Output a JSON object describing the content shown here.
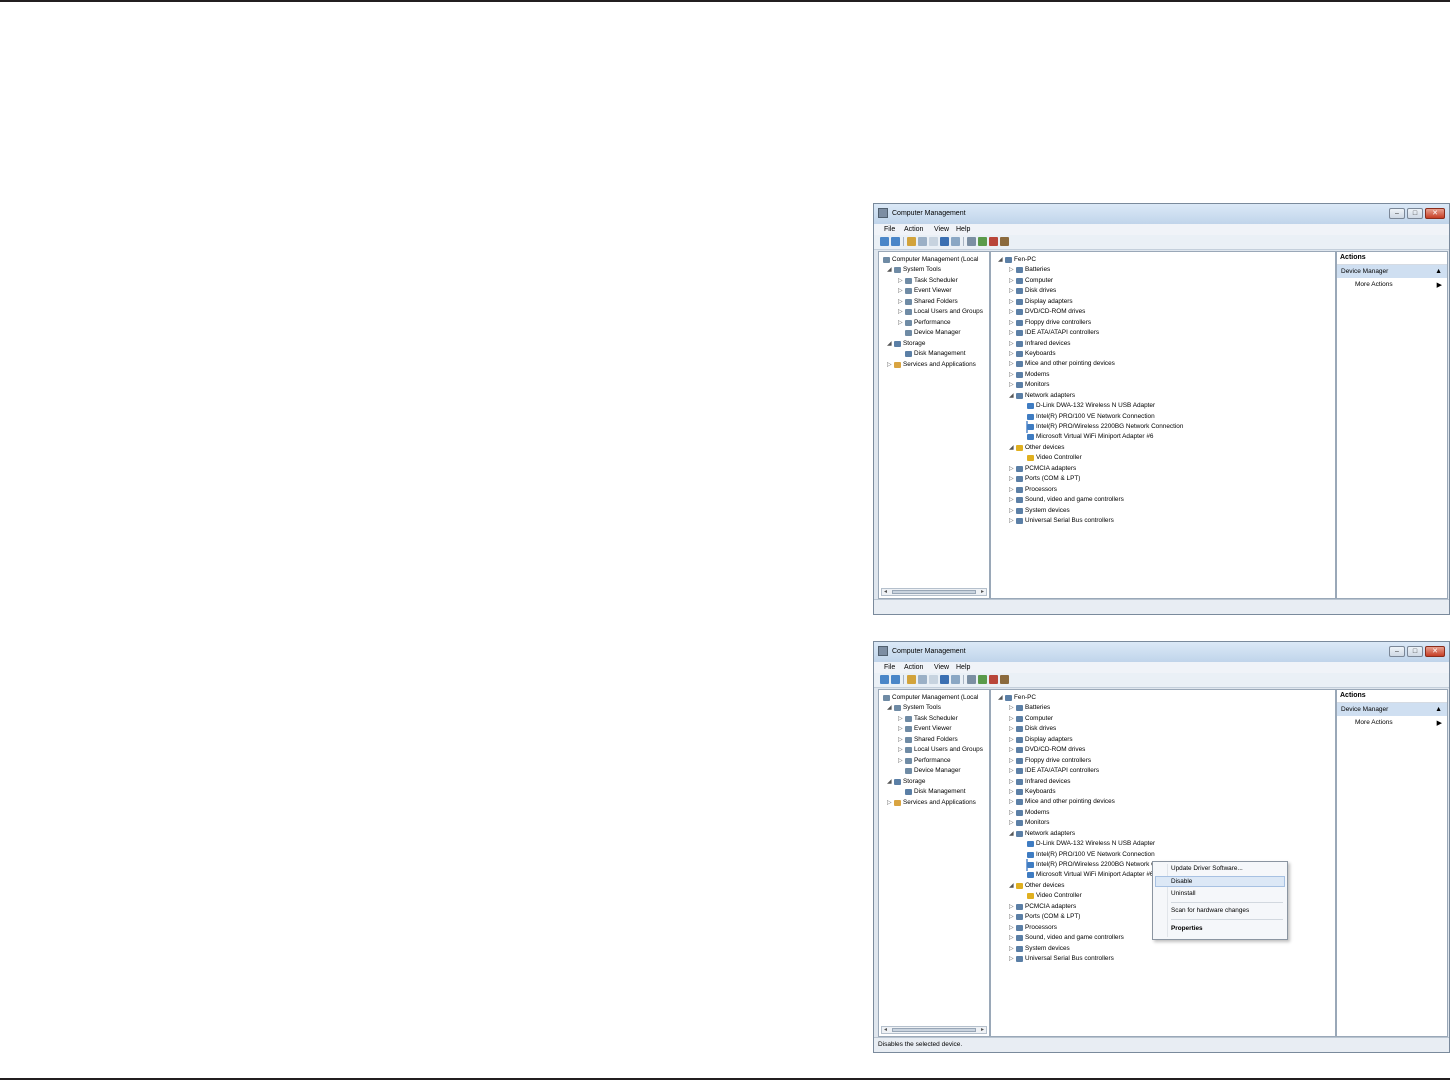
{
  "windows": [
    {
      "title": "Computer Management",
      "menu": [
        "File",
        "Action",
        "View",
        "Help"
      ],
      "window_controls": [
        "minimize",
        "maximize",
        "close"
      ],
      "tree": [
        {
          "label": "Computer Management (Local",
          "expander": ""
        },
        {
          "label": "System Tools",
          "expander": "◢"
        },
        {
          "label": "Task Scheduler",
          "expander": "▷"
        },
        {
          "label": "Event Viewer",
          "expander": "▷"
        },
        {
          "label": "Shared Folders",
          "expander": "▷"
        },
        {
          "label": "Local Users and Groups",
          "expander": "▷"
        },
        {
          "label": "Performance",
          "expander": "▷"
        },
        {
          "label": "Device Manager",
          "expander": ""
        },
        {
          "label": "Storage",
          "expander": "◢"
        },
        {
          "label": "Disk Management",
          "expander": ""
        },
        {
          "label": "Services and Applications",
          "expander": "▷"
        }
      ],
      "devices": [
        {
          "label": "Fen-PC",
          "expander": "◢"
        },
        {
          "label": "Batteries",
          "expander": "▷"
        },
        {
          "label": "Computer",
          "expander": "▷"
        },
        {
          "label": "Disk drives",
          "expander": "▷"
        },
        {
          "label": "Display adapters",
          "expander": "▷"
        },
        {
          "label": "DVD/CD-ROM drives",
          "expander": "▷"
        },
        {
          "label": "Floppy drive controllers",
          "expander": "▷"
        },
        {
          "label": "IDE ATA/ATAPI controllers",
          "expander": "▷"
        },
        {
          "label": "Infrared devices",
          "expander": "▷"
        },
        {
          "label": "Keyboards",
          "expander": "▷"
        },
        {
          "label": "Mice and other pointing devices",
          "expander": "▷"
        },
        {
          "label": "Modems",
          "expander": "▷"
        },
        {
          "label": "Monitors",
          "expander": "▷"
        },
        {
          "label": "Network adapters",
          "expander": "◢"
        },
        {
          "label": "D-Link DWA-132 Wireless N USB Adapter",
          "expander": ""
        },
        {
          "label": "Intel(R) PRO/100 VE Network Connection",
          "expander": ""
        },
        {
          "label": "Intel(R) PRO/Wireless 2200BG Network Connection",
          "expander": ""
        },
        {
          "label": "Microsoft Virtual WiFi Miniport Adapter #6",
          "expander": ""
        },
        {
          "label": "Other devices",
          "expander": "◢"
        },
        {
          "label": "Video Controller",
          "expander": ""
        },
        {
          "label": "PCMCIA adapters",
          "expander": "▷"
        },
        {
          "label": "Ports (COM & LPT)",
          "expander": "▷"
        },
        {
          "label": "Processors",
          "expander": "▷"
        },
        {
          "label": "Sound, video and game controllers",
          "expander": "▷"
        },
        {
          "label": "System devices",
          "expander": "▷"
        },
        {
          "label": "Universal Serial Bus controllers",
          "expander": "▷"
        }
      ],
      "selected_device": "Intel(R) PRO/Wireless 2200BG Network Connection",
      "actions": {
        "title": "Actions",
        "section": "Device Manager",
        "more": "More Actions"
      },
      "status": ""
    },
    {
      "title": "Computer Management",
      "menu": [
        "File",
        "Action",
        "View",
        "Help"
      ],
      "window_controls": [
        "minimize",
        "maximize",
        "close"
      ],
      "tree": [
        {
          "label": "Computer Management (Local",
          "expander": ""
        },
        {
          "label": "System Tools",
          "expander": "◢"
        },
        {
          "label": "Task Scheduler",
          "expander": "▷"
        },
        {
          "label": "Event Viewer",
          "expander": "▷"
        },
        {
          "label": "Shared Folders",
          "expander": "▷"
        },
        {
          "label": "Local Users and Groups",
          "expander": "▷"
        },
        {
          "label": "Performance",
          "expander": "▷"
        },
        {
          "label": "Device Manager",
          "expander": ""
        },
        {
          "label": "Storage",
          "expander": "◢"
        },
        {
          "label": "Disk Management",
          "expander": ""
        },
        {
          "label": "Services and Applications",
          "expander": "▷"
        }
      ],
      "devices": [
        {
          "label": "Fen-PC",
          "expander": "◢"
        },
        {
          "label": "Batteries",
          "expander": "▷"
        },
        {
          "label": "Computer",
          "expander": "▷"
        },
        {
          "label": "Disk drives",
          "expander": "▷"
        },
        {
          "label": "Display adapters",
          "expander": "▷"
        },
        {
          "label": "DVD/CD-ROM drives",
          "expander": "▷"
        },
        {
          "label": "Floppy drive controllers",
          "expander": "▷"
        },
        {
          "label": "IDE ATA/ATAPI controllers",
          "expander": "▷"
        },
        {
          "label": "Infrared devices",
          "expander": "▷"
        },
        {
          "label": "Keyboards",
          "expander": "▷"
        },
        {
          "label": "Mice and other pointing devices",
          "expander": "▷"
        },
        {
          "label": "Modems",
          "expander": "▷"
        },
        {
          "label": "Monitors",
          "expander": "▷"
        },
        {
          "label": "Network adapters",
          "expander": "◢"
        },
        {
          "label": "D-Link DWA-132 Wireless N USB Adapter",
          "expander": ""
        },
        {
          "label": "Intel(R) PRO/100 VE Network Connection",
          "expander": ""
        },
        {
          "label": "Intel(R) PRO/Wireless 2200BG Network Connection",
          "expander": ""
        },
        {
          "label": "Microsoft Virtual WiFi Miniport Adapter #6",
          "expander": ""
        },
        {
          "label": "Other devices",
          "expander": "◢"
        },
        {
          "label": "Video Controller",
          "expander": ""
        },
        {
          "label": "PCMCIA adapters",
          "expander": "▷"
        },
        {
          "label": "Ports (COM & LPT)",
          "expander": "▷"
        },
        {
          "label": "Processors",
          "expander": "▷"
        },
        {
          "label": "Sound, video and game controllers",
          "expander": "▷"
        },
        {
          "label": "System devices",
          "expander": "▷"
        },
        {
          "label": "Universal Serial Bus controllers",
          "expander": "▷"
        }
      ],
      "selected_device": "Intel(R) PRO/Wireless 2200BG Network Connection",
      "actions": {
        "title": "Actions",
        "section": "Device Manager",
        "more": "More Actions"
      },
      "context_menu": [
        "Update Driver Software...",
        "Disable",
        "Uninstall",
        "Scan for hardware changes",
        "Properties"
      ],
      "context_menu_highlight": "Disable",
      "status": "Disables the selected device."
    }
  ],
  "icon_colors": {
    "device": "#5b7fa6",
    "network": "#3f7cc2",
    "warning": "#e0b020",
    "folder": "#d9a441",
    "tool": "#6f8ba5"
  },
  "toolbar_icons": [
    "back-icon",
    "forward-icon",
    "up-icon",
    "show-hide-tree-icon",
    "properties-icon",
    "help-icon",
    "view-icon",
    "scan-icon",
    "update-driver-icon",
    "uninstall-icon",
    "disable-icon"
  ]
}
